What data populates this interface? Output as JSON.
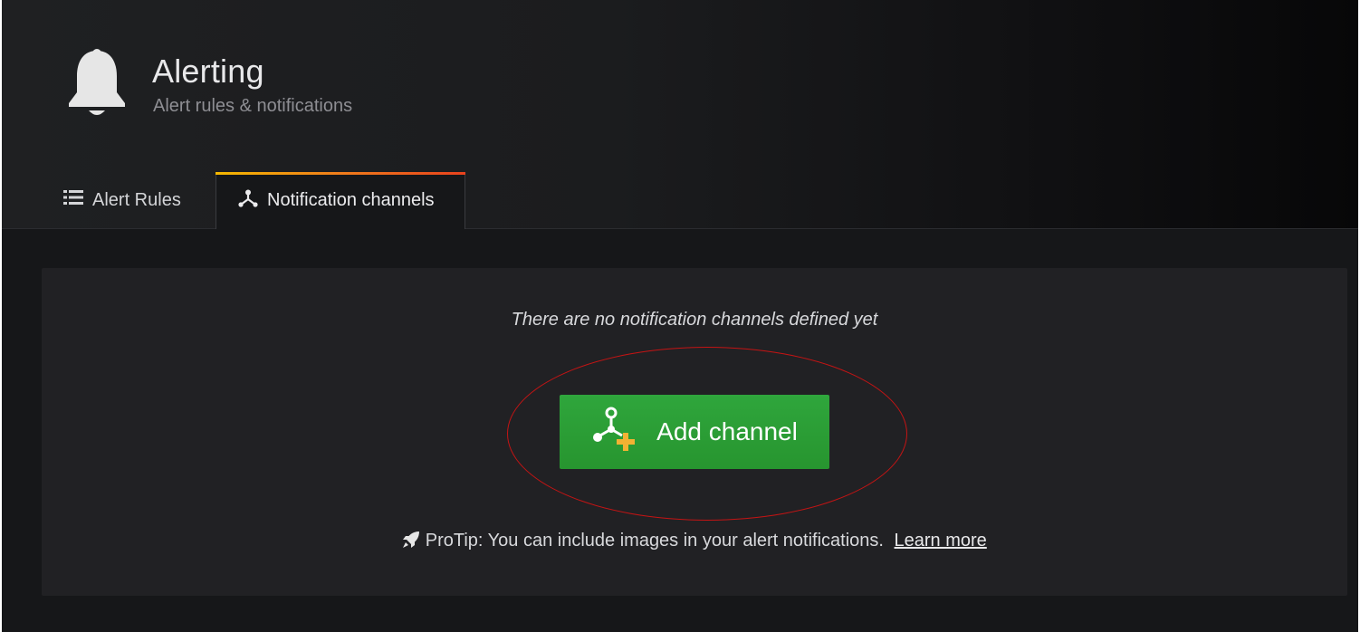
{
  "header": {
    "title": "Alerting",
    "subtitle": "Alert rules & notifications",
    "icon": "bell-icon"
  },
  "tabs": [
    {
      "label": "Alert Rules",
      "icon": "list-icon",
      "active": false
    },
    {
      "label": "Notification channels",
      "icon": "share-nodes-icon",
      "active": true
    }
  ],
  "panel": {
    "empty_message": "There are no notification channels defined yet",
    "add_button_label": "Add channel",
    "add_button_icon": "add-channel-icon",
    "protip_text": "ProTip: You can include images in your alert notifications.",
    "protip_icon": "rocket-icon",
    "learn_more_label": "Learn more"
  },
  "colors": {
    "accent_gradient": [
      "#f5b800",
      "#e8421d"
    ],
    "button_green": "#2fa63c",
    "annotation_red": "#c41414"
  }
}
